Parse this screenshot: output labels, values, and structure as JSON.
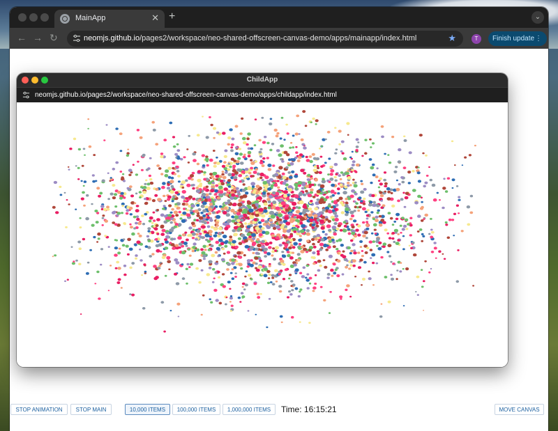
{
  "browser": {
    "tab_title": "MainApp",
    "tab_close": "✕",
    "new_tab": "+",
    "url_host": "neomjs.github.io",
    "url_path": "/pages2/workspace/neo-shared-offscreen-canvas-demo/apps/mainapp/index.html",
    "profile_initial": "T",
    "update_label": "Finish update",
    "kebab": "⋮",
    "back": "←",
    "forward": "→",
    "reload": "↻",
    "star": "★",
    "tab_menu": "⌄"
  },
  "child_window": {
    "title": "ChildApp",
    "url_host": "neomjs.github.io",
    "url_path": "/pages2/workspace/neo-shared-offscreen-canvas-demo/apps/childapp/index.html",
    "traffic_colors": [
      "#ff5f57",
      "#febc2e",
      "#28c840"
    ],
    "particle_colors": [
      "#e91e63",
      "#2e6db4",
      "#f7e98e",
      "#b0473a",
      "#9c8cc4",
      "#6dbf6b",
      "#f5a27a",
      "#ff4081",
      "#8e9aa8"
    ]
  },
  "controls": {
    "stop_animation": "STOP ANIMATION",
    "stop_main": "STOP MAIN",
    "items_10k": "10,000 ITEMS",
    "items_100k": "100,000 ITEMS",
    "items_1m": "1,000,000 ITEMS",
    "time_label": "Time: 16:15:21",
    "move_canvas": "MOVE CANVAS"
  }
}
